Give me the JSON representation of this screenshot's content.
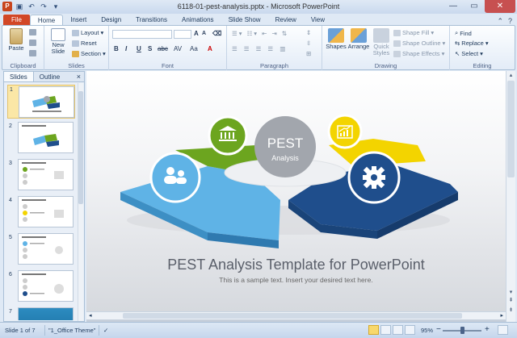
{
  "app": {
    "window_title": "6118-01-pest-analysis.pptx - Microsoft PowerPoint"
  },
  "tabs": [
    "File",
    "Home",
    "Insert",
    "Design",
    "Transitions",
    "Animations",
    "Slide Show",
    "Review",
    "View"
  ],
  "active_tab": "Home",
  "ribbon": {
    "clipboard": {
      "label": "Clipboard",
      "paste": "Paste"
    },
    "slides": {
      "label": "Slides",
      "new_slide_1": "New",
      "new_slide_2": "Slide",
      "layout": "Layout",
      "reset": "Reset",
      "section": "Section"
    },
    "font": {
      "label": "Font",
      "bold": "B",
      "italic": "I",
      "underline": "U",
      "strike": "S",
      "abc": "abc",
      "av": "AV",
      "aa": "Aa",
      "grow": "A",
      "shrink": "A",
      "color": "A"
    },
    "paragraph": {
      "label": "Paragraph"
    },
    "drawing": {
      "label": "Drawing",
      "shapes": "Shapes",
      "arrange": "Arrange",
      "quick_styles_1": "Quick",
      "quick_styles_2": "Styles",
      "shape_fill": "Shape Fill",
      "shape_outline": "Shape Outline",
      "shape_effects": "Shape Effects"
    },
    "editing": {
      "label": "Editing",
      "find": "Find",
      "replace": "Replace",
      "select": "Select"
    }
  },
  "slide_pane": {
    "tabs": [
      "Slides",
      "Outline"
    ],
    "close": "×",
    "thumbnails": [
      {
        "num": "1",
        "selected": true
      },
      {
        "num": "2",
        "selected": false
      },
      {
        "num": "3",
        "selected": false
      },
      {
        "num": "4",
        "selected": false
      },
      {
        "num": "5",
        "selected": false
      },
      {
        "num": "6",
        "selected": false
      },
      {
        "num": "7",
        "selected": false
      }
    ]
  },
  "slide": {
    "center_title": "PEST",
    "center_subtitle": "Analysis",
    "title": "PEST Analysis Template for PowerPoint",
    "subtitle": "This is a sample text. Insert your desired text here.",
    "colors": {
      "blue_light": "#5fb3e6",
      "green": "#6ca51f",
      "yellow": "#f3d400",
      "blue_dark": "#1f4e8c",
      "gray_circle": "#a2a6ad"
    }
  },
  "status": {
    "slide_of": "Slide 1 of 7",
    "theme": "\"1_Office Theme\"",
    "zoom": "95%"
  },
  "icons": [
    "ppt-logo-icon",
    "save-icon",
    "undo-icon",
    "redo-icon",
    "minimize-icon",
    "maximize-icon",
    "close-icon",
    "people-icon",
    "bank-icon",
    "chart-icon",
    "gear-icon"
  ]
}
